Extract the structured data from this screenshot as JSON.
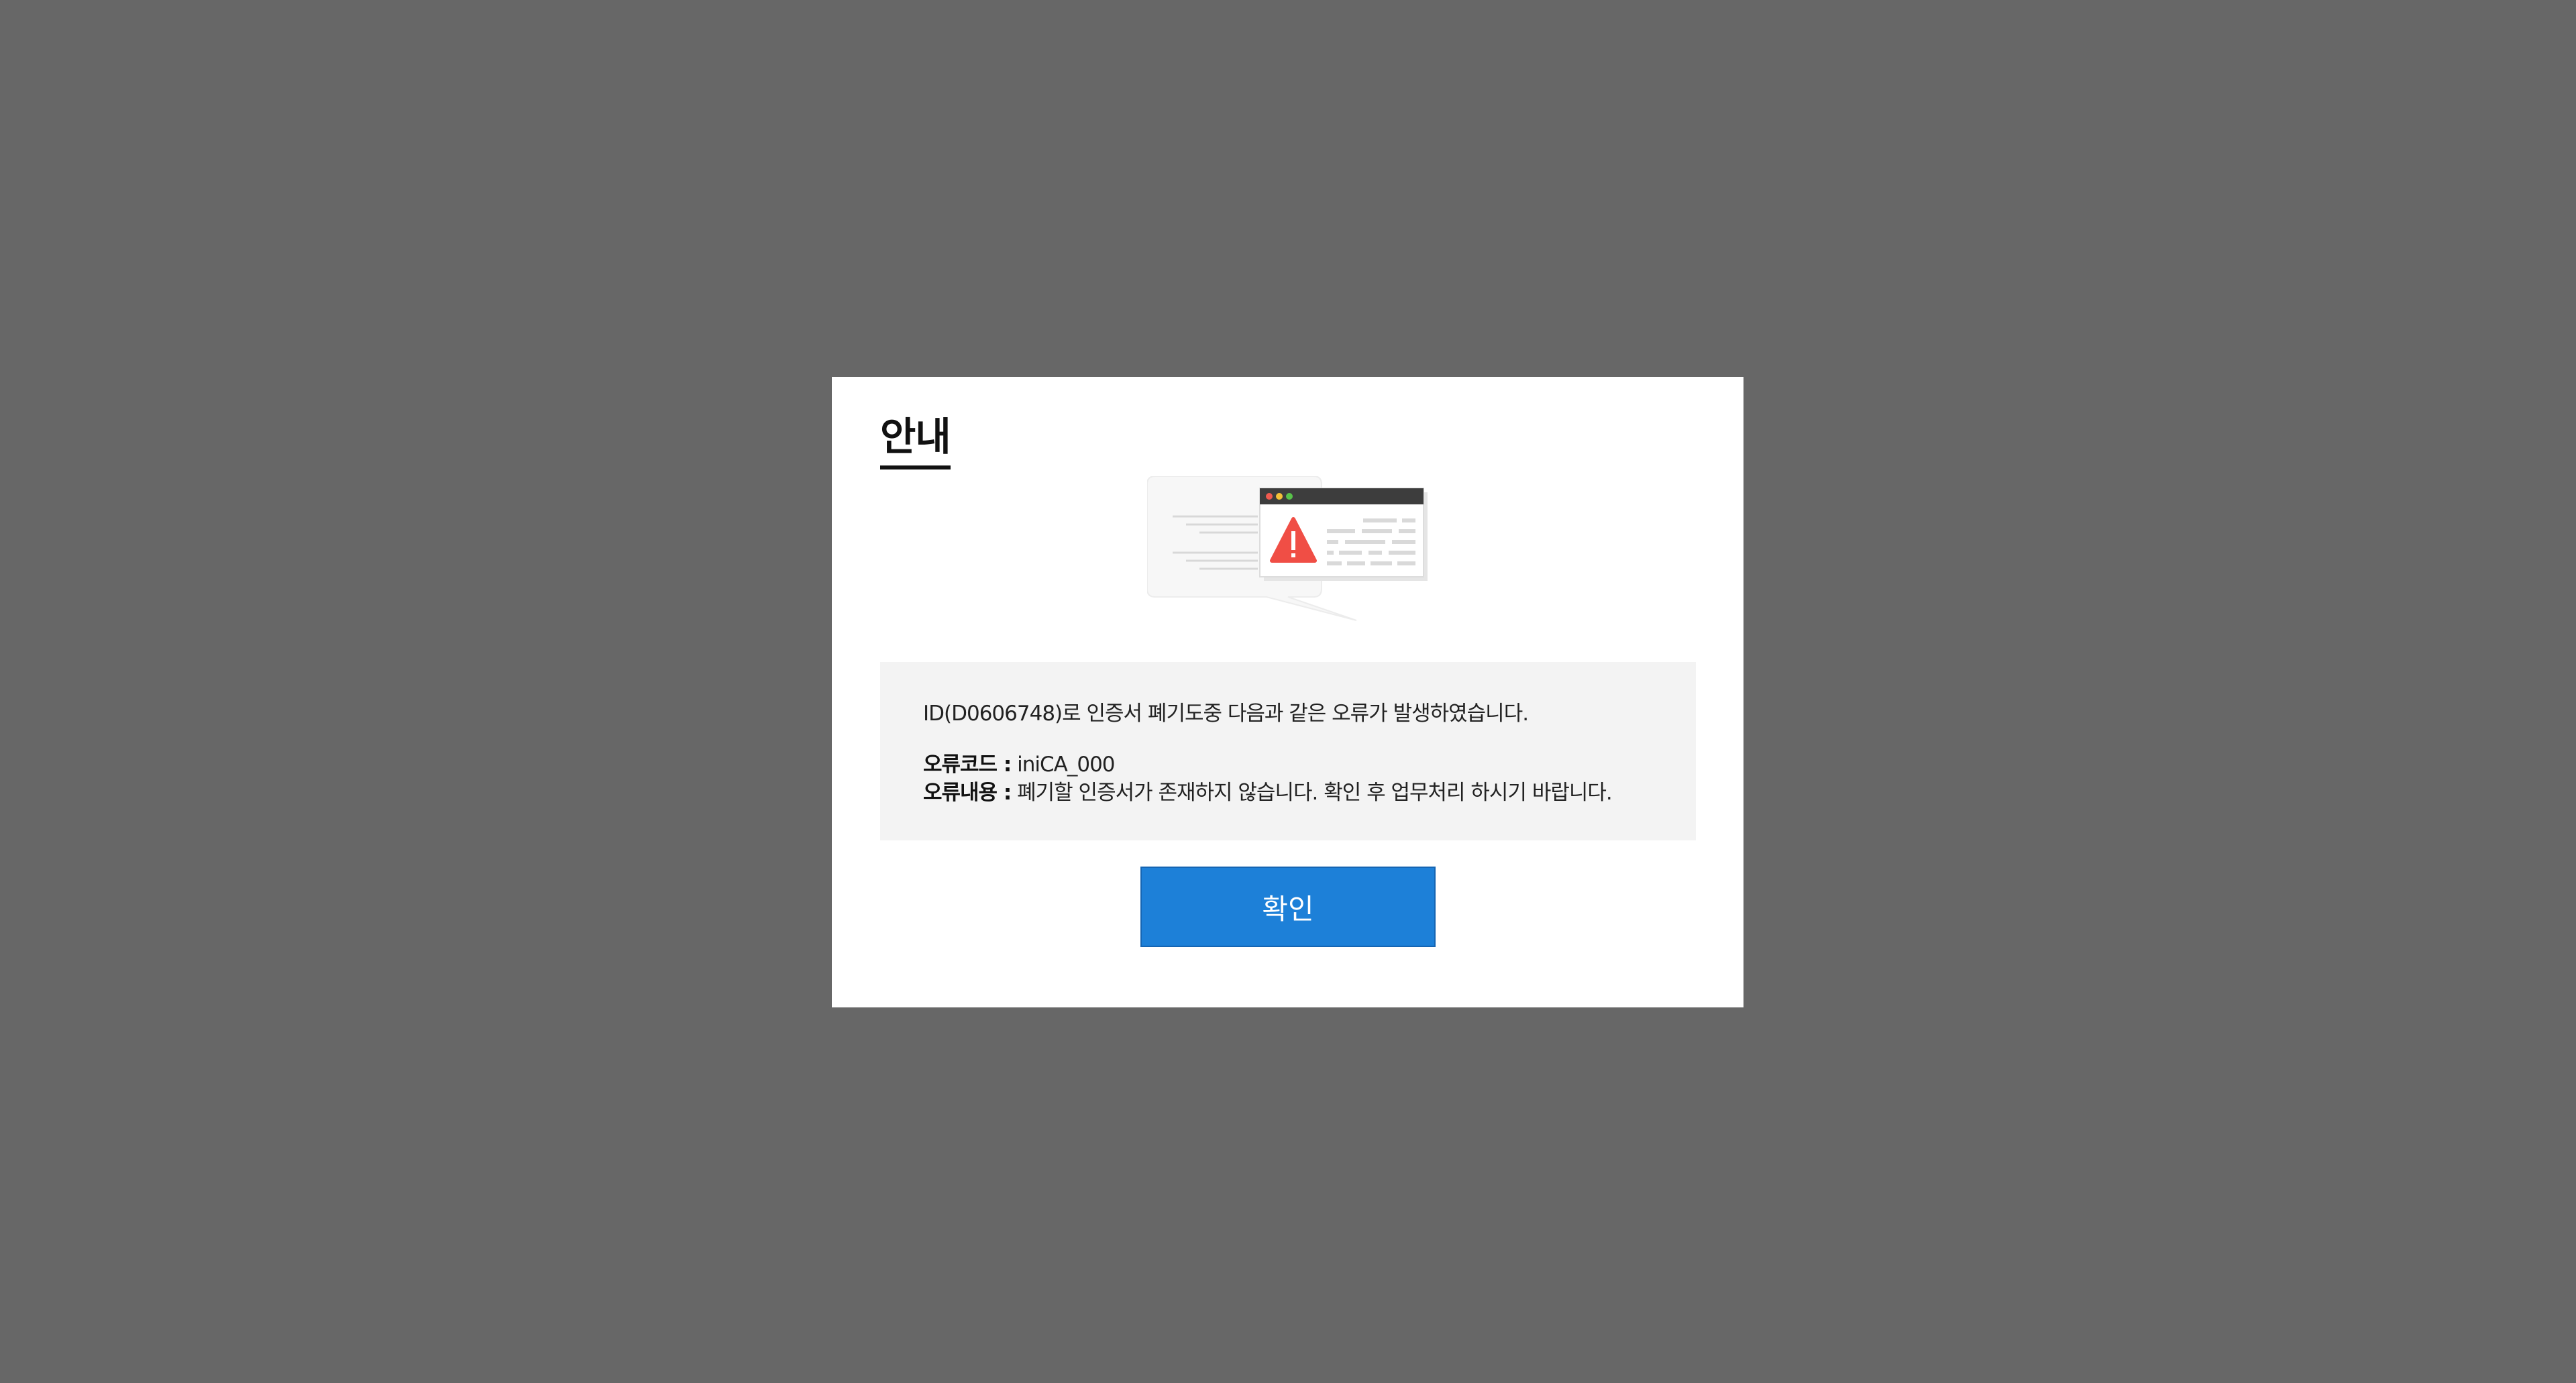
{
  "dialog": {
    "title": "안내",
    "illustration_icon": "error-window-icon",
    "message": {
      "intro": "ID(D0606748)로 인증서 폐기도중 다음과 같은 오류가 발생하였습니다.",
      "code_label": "오류코드 :",
      "code_value": " iniCA_000",
      "detail_label": "오류내용 :",
      "detail_value": " 폐기할 인증서가 존재하지 않습니다. 확인 후 업무처리 하시기 바랍니다."
    },
    "confirm_label": "확인"
  },
  "colors": {
    "overlay": "#676767",
    "dialog_bg": "#ffffff",
    "message_bg": "#f3f3f3",
    "button_bg": "#1d80d8",
    "warning_red": "#f04e45"
  }
}
